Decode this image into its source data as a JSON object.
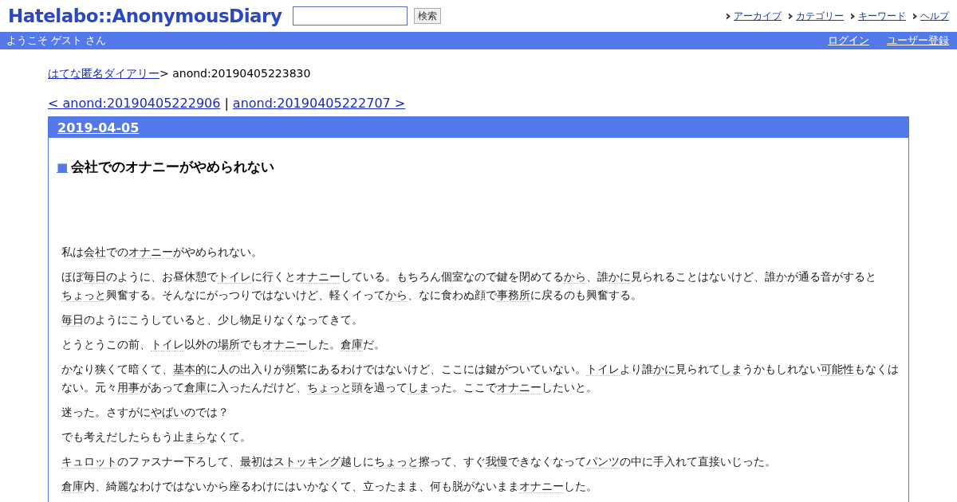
{
  "header": {
    "logo": "Hatelabo::AnonymousDiary",
    "search": {
      "button": "検索"
    },
    "nav": [
      "アーカイブ",
      "カテゴリー",
      "キーワード",
      "ヘルプ"
    ]
  },
  "userbar": {
    "greeting": "ようこそ ゲスト さん",
    "links": [
      "ログイン",
      "ユーザー登録"
    ]
  },
  "breadcrumb": {
    "link": "はてな匿名ダイアリー",
    "current": "> anond:20190405223830"
  },
  "pager": {
    "prev": "< anond:20190405222906",
    "separator": "|",
    "next": "anond:20190405222707 >"
  },
  "entry": {
    "date": "2019-04-05",
    "title_mark": "■",
    "title": "会社でのオナニーがやめられない",
    "paragraphs": [
      [
        {
          "text": "私は",
          "keyword": false
        },
        {
          "text": "会社",
          "keyword": true
        },
        {
          "text": "での",
          "keyword": false
        },
        {
          "text": "オナニー",
          "keyword": true
        },
        {
          "text": "がやめられない。",
          "keyword": false
        }
      ],
      [
        {
          "text": "ほぼ",
          "keyword": false
        },
        {
          "text": "毎日",
          "keyword": true
        },
        {
          "text": "のように、お昼休憩で",
          "keyword": false
        },
        {
          "text": "トイレ",
          "keyword": true
        },
        {
          "text": "に行くと",
          "keyword": false
        },
        {
          "text": "オナニー",
          "keyword": true
        },
        {
          "text": "している。もちろん個室なので鍵を閉めてる",
          "keyword": false
        },
        {
          "text": "から",
          "keyword": true
        },
        {
          "text": "、誰",
          "keyword": false
        },
        {
          "text": "かに",
          "keyword": true
        },
        {
          "text": "見られることはないけど、誰かが通る音がすると",
          "keyword": false
        },
        {
          "text": "ちょっと",
          "keyword": true
        },
        {
          "text": "興奮する。そんなにがっつりではないけど、軽くイって",
          "keyword": false
        },
        {
          "text": "から",
          "keyword": true
        },
        {
          "text": "、なに食わぬ顔で",
          "keyword": false
        },
        {
          "text": "事務所",
          "keyword": true
        },
        {
          "text": "に戻るのも興奮する。",
          "keyword": false
        }
      ],
      [
        {
          "text": "毎日",
          "keyword": true
        },
        {
          "text": "のようにこうしていると、少し物足りなくなってきて。",
          "keyword": false
        }
      ],
      [
        {
          "text": "とうとうこの前、",
          "keyword": false
        },
        {
          "text": "トイレ",
          "keyword": true
        },
        {
          "text": "以外の",
          "keyword": false
        },
        {
          "text": "場所",
          "keyword": true
        },
        {
          "text": "でも",
          "keyword": false
        },
        {
          "text": "オナニー",
          "keyword": true
        },
        {
          "text": "した。",
          "keyword": false
        },
        {
          "text": "倉庫",
          "keyword": true
        },
        {
          "text": "だ。",
          "keyword": false
        }
      ],
      [
        {
          "text": "かなり狭くて暗くて、",
          "keyword": false
        },
        {
          "text": "基本的",
          "keyword": true
        },
        {
          "text": "に人の出入りが頻繁にあるわけではないけど、ここには鍵がついていない。",
          "keyword": false
        },
        {
          "text": "トイレ",
          "keyword": true
        },
        {
          "text": "より誰",
          "keyword": false
        },
        {
          "text": "かに",
          "keyword": true
        },
        {
          "text": "見られて",
          "keyword": false
        },
        {
          "text": "しま",
          "keyword": true
        },
        {
          "text": "うかもしれない",
          "keyword": false
        },
        {
          "text": "可能性",
          "keyword": true
        },
        {
          "text": "もなくはない。元々",
          "keyword": false
        },
        {
          "text": "用事",
          "keyword": true
        },
        {
          "text": "があって",
          "keyword": false
        },
        {
          "text": "倉庫",
          "keyword": true
        },
        {
          "text": "に入ったんだけど、",
          "keyword": false
        },
        {
          "text": "ちょっと",
          "keyword": true
        },
        {
          "text": "頭を過って",
          "keyword": false
        },
        {
          "text": "しま",
          "keyword": true
        },
        {
          "text": "った。ここで",
          "keyword": false
        },
        {
          "text": "オナニー",
          "keyword": true
        },
        {
          "text": "したいと。",
          "keyword": false
        }
      ],
      [
        {
          "text": "迷った。さすがに",
          "keyword": false
        },
        {
          "text": "やばい",
          "keyword": true
        },
        {
          "text": "のでは？",
          "keyword": false
        }
      ],
      [
        {
          "text": "でも考えだしたらもう止",
          "keyword": false
        },
        {
          "text": "まら",
          "keyword": true
        },
        {
          "text": "なくて。",
          "keyword": false
        }
      ],
      [
        {
          "text": "キュロット",
          "keyword": true
        },
        {
          "text": "のファスナー下ろして、",
          "keyword": false
        },
        {
          "text": "最初",
          "keyword": true
        },
        {
          "text": "は",
          "keyword": false
        },
        {
          "text": "ストッキング",
          "keyword": true
        },
        {
          "text": "越しに",
          "keyword": false
        },
        {
          "text": "ちょっと",
          "keyword": true
        },
        {
          "text": "擦って、すぐ",
          "keyword": false
        },
        {
          "text": "我慢",
          "keyword": true
        },
        {
          "text": "できなくなって",
          "keyword": false
        },
        {
          "text": "パンツ",
          "keyword": true
        },
        {
          "text": "の中に手入れて直接いじった。",
          "keyword": false
        }
      ],
      [
        {
          "text": "倉庫",
          "keyword": true
        },
        {
          "text": "内、綺麗なわけではないから座るわけにはいかなくて、立ったまま、何も脱がないまま",
          "keyword": false
        },
        {
          "text": "オナニー",
          "keyword": true
        },
        {
          "text": "した。",
          "keyword": false
        }
      ]
    ]
  }
}
